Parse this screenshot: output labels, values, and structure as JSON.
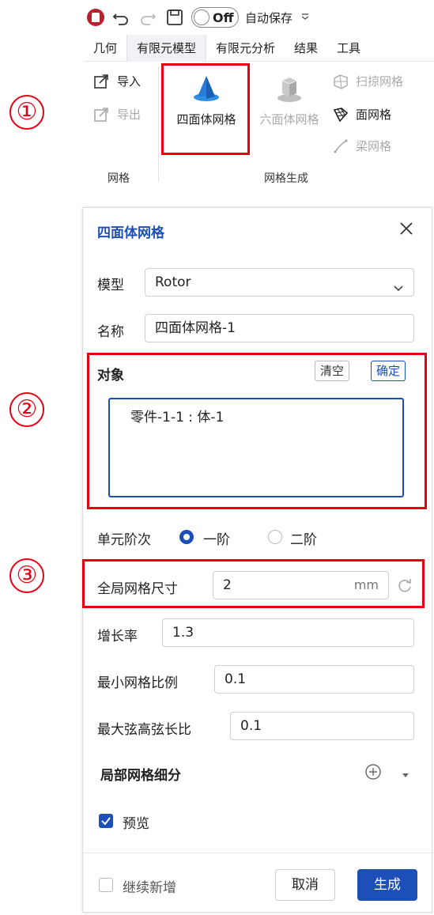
{
  "markers": [
    "①",
    "②",
    "③"
  ],
  "toolbar": {
    "toggle_label": "Off",
    "autosave_label": "自动保存",
    "menu_tabs": [
      "几何",
      "有限元模型",
      "有限元分析",
      "结果",
      "工具"
    ],
    "import_label": "导入",
    "export_label": "导出",
    "mesh_group_label": "网格",
    "tet_mesh_label": "四面体网格",
    "hex_mesh_label": "六面体网格",
    "sweep_mesh_label": "扫掠网格",
    "surface_mesh_label": "面网格",
    "beam_mesh_label": "梁网格",
    "mesh_gen_group_label": "网格生成"
  },
  "dialog": {
    "title": "四面体网格",
    "model_label": "模型",
    "model_value": "Rotor",
    "name_label": "名称",
    "name_value": "四面体网格-1",
    "object_label": "对象",
    "clear_label": "清空",
    "confirm_label": "确定",
    "object_items": [
      "零件-1-1 : 体-1"
    ],
    "element_order_label": "单元阶次",
    "order_first": "一阶",
    "order_second": "二阶",
    "global_size_label": "全局网格尺寸",
    "global_size_value": "2",
    "global_size_unit": "mm",
    "growth_label": "增长率",
    "growth_value": "1.3",
    "min_ratio_label": "最小网格比例",
    "min_ratio_value": "0.1",
    "max_chord_label": "最大弦高弦长比",
    "max_chord_value": "0.1",
    "local_refine_label": "局部网格细分",
    "preview_label": "预览",
    "preview_checked": true,
    "continue_label": "继续新增",
    "continue_checked": false,
    "cancel_label": "取消",
    "generate_label": "生成"
  },
  "colors": {
    "accent": "#1d4fb8",
    "highlight": "#e60012"
  }
}
